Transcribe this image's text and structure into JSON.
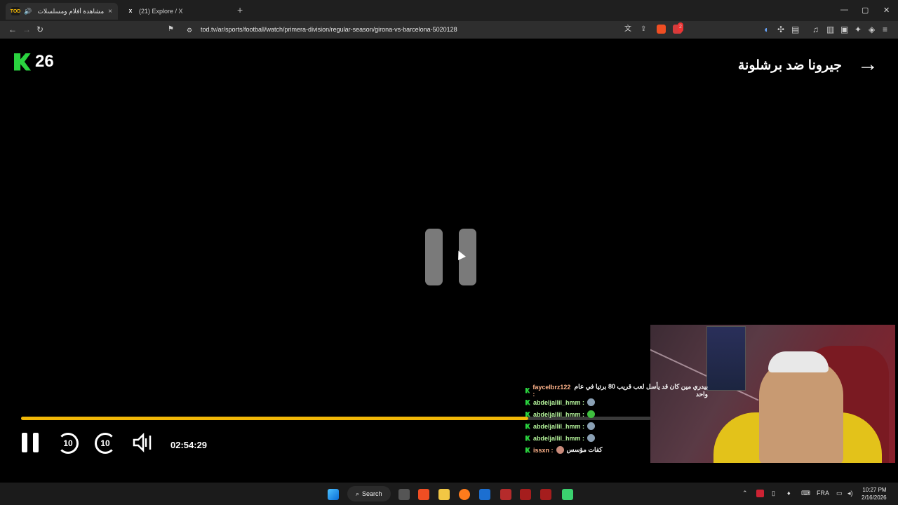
{
  "browser": {
    "tabs": [
      {
        "title": "مشاهدة أفلام ومسلسلات وبرا",
        "favicon": "TOD",
        "active": true,
        "muted_icon": "speaker-icon",
        "close": "×"
      },
      {
        "title": "(21) Explore / X",
        "favicon": "X",
        "active": false,
        "close": "×"
      }
    ],
    "new_tab": "+",
    "window_controls": {
      "minimize": "—",
      "maximize": "▢",
      "close": "✕"
    },
    "url": "tod.tv/ar/sports/football/watch/primera-division/regular-season/girona-vs-barcelona-5020128",
    "nav": {
      "back": "←",
      "forward": "→",
      "reload": "↻",
      "bookmark": "🔖"
    },
    "brave_badge": "2"
  },
  "player": {
    "brand_number": "26",
    "match_title": "جيرونا ضد برشلونة",
    "back_arrow": "→",
    "timecode": "02:54:29",
    "progress": 0.805,
    "skip_back": "10",
    "skip_forward": "10",
    "accent": "#f2b807"
  },
  "chat": [
    {
      "user": "faycelbrz122 :",
      "msg": "بيدري مين كان قد يأسل لعب قريب 80 برتيا في عام واحد",
      "highlight": true
    },
    {
      "user": "abdeljallil_hmm :",
      "emote": "popcorn-emote"
    },
    {
      "user": "abdeljallil_hmm :",
      "emote": "green-emote"
    },
    {
      "user": "abdeljallil_hmm :",
      "emote": "popcorn-emote"
    },
    {
      "user": "abdeljallil_hmm :",
      "emote": "popcorn-emote"
    },
    {
      "user": "issxn :",
      "emote": "face-emote",
      "msg": "كفات مؤسس"
    }
  ],
  "taskbar": {
    "search_label": "Search",
    "language": "FRA",
    "time": "10:27 PM",
    "date": "2/16/2026"
  }
}
